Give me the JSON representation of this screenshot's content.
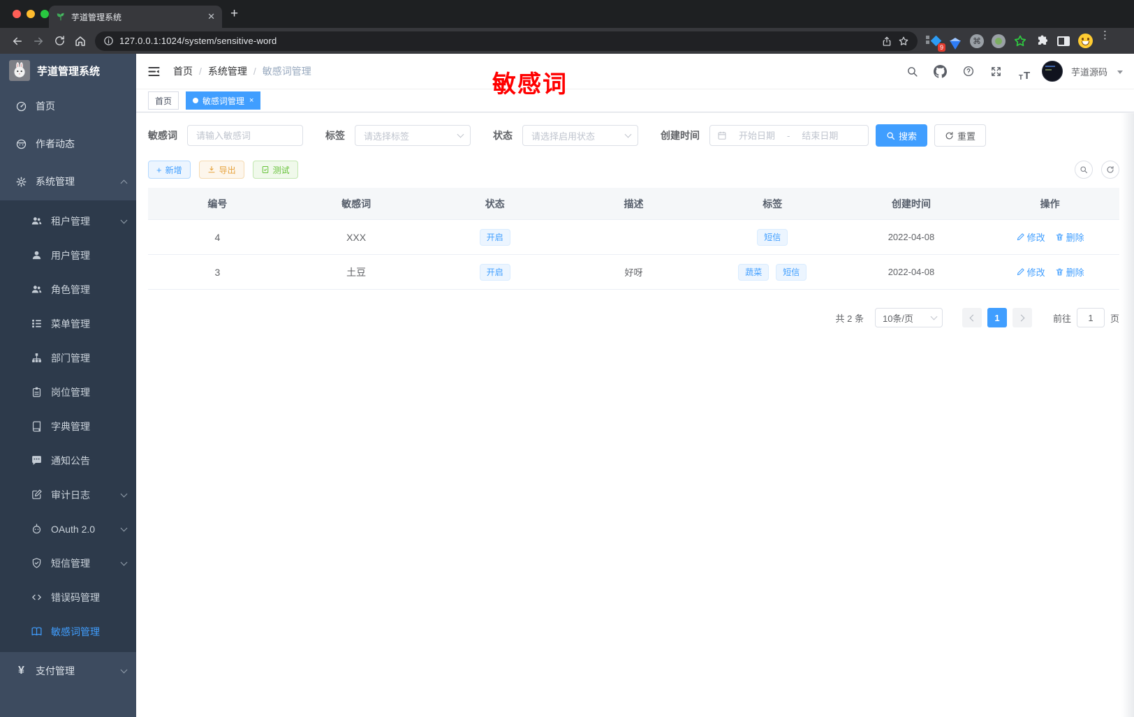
{
  "browser": {
    "tab": {
      "title": "芋道管理系统"
    },
    "url": "127.0.0.1:1024/system/sensitive-word",
    "extensions_badge": "9"
  },
  "app": {
    "logo_title": "芋道管理系统",
    "annotation": "敏感词",
    "header": {
      "breadcrumb": {
        "items": [
          "首页",
          "系统管理",
          "敏感词管理"
        ],
        "separator": "/"
      },
      "user_name": "芋道源码"
    },
    "tags_view": [
      {
        "label": "首页",
        "active": false
      },
      {
        "label": "敏感词管理",
        "active": true
      }
    ]
  },
  "sidebar": {
    "items": [
      {
        "label": "首页",
        "icon": "dashboard-icon"
      },
      {
        "label": "作者动态",
        "icon": "chat-face-icon"
      },
      {
        "label": "系统管理",
        "icon": "gear-icon",
        "chevron": "up",
        "expanded": true
      },
      {
        "label": "租户管理",
        "icon": "tenant-users-icon",
        "chevron": "down"
      },
      {
        "label": "用户管理",
        "icon": "user-icon"
      },
      {
        "label": "角色管理",
        "icon": "role-users-icon"
      },
      {
        "label": "菜单管理",
        "icon": "menu-tree-icon"
      },
      {
        "label": "部门管理",
        "icon": "org-chart-icon"
      },
      {
        "label": "岗位管理",
        "icon": "post-badge-icon"
      },
      {
        "label": "字典管理",
        "icon": "dictionary-book-icon"
      },
      {
        "label": "通知公告",
        "icon": "announcement-icon"
      },
      {
        "label": "审计日志",
        "icon": "audit-log-icon",
        "chevron": "down"
      },
      {
        "label": "OAuth 2.0",
        "icon": "oauth-robot-icon",
        "chevron": "down"
      },
      {
        "label": "短信管理",
        "icon": "sms-shield-icon",
        "chevron": "down"
      },
      {
        "label": "错误码管理",
        "icon": "error-code-icon"
      },
      {
        "label": "敏感词管理",
        "icon": "sensitive-word-book-icon",
        "active": true
      },
      {
        "label": "支付管理",
        "icon": "payment-yen-icon",
        "chevron": "down"
      }
    ]
  },
  "filters": {
    "keyword": {
      "label": "敏感词",
      "placeholder": "请输入敏感词"
    },
    "tag": {
      "label": "标签",
      "placeholder": "请选择标签"
    },
    "status": {
      "label": "状态",
      "placeholder": "请选择启用状态"
    },
    "created": {
      "label": "创建时间",
      "start": "开始日期",
      "sep": "-",
      "end": "结束日期"
    },
    "search": "搜索",
    "reset": "重置"
  },
  "toolbar": {
    "add": "新增",
    "export": "导出",
    "test": "测试"
  },
  "table": {
    "columns": [
      "编号",
      "敏感词",
      "状态",
      "描述",
      "标签",
      "创建时间",
      "操作"
    ],
    "actions": {
      "edit": "修改",
      "delete": "删除"
    },
    "rows": [
      {
        "id": "4",
        "word": "XXX",
        "status": "开启",
        "description": "",
        "tags": [
          "短信"
        ],
        "created": "2022-04-08"
      },
      {
        "id": "3",
        "word": "土豆",
        "status": "开启",
        "description": "好呀",
        "tags": [
          "蔬菜",
          "短信"
        ],
        "created": "2022-04-08"
      }
    ]
  },
  "pagination": {
    "total": "共 2 条",
    "size": "10条/页",
    "page": "1",
    "goto": "前往",
    "goto_value": "1",
    "unit": "页"
  },
  "colors": {
    "primary": "#409eff",
    "warning": "#e6a23c",
    "success": "#67c23a",
    "annotation_red": "#ff0000",
    "sidebar_bg": "#3d4b5f",
    "submenu_bg": "#2d3a4b",
    "tag_bg": "#ecf5ff"
  }
}
